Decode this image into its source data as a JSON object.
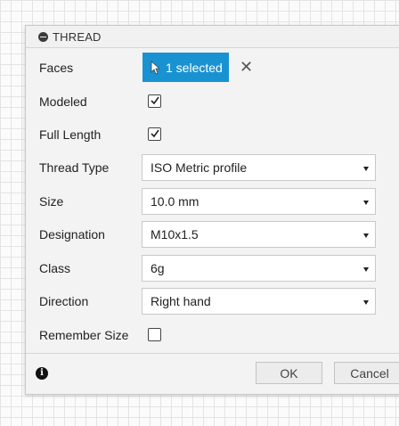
{
  "dialog": {
    "title": "THREAD"
  },
  "fields": {
    "faces": {
      "label": "Faces",
      "selection": "1 selected",
      "clear_icon": "close-icon"
    },
    "modeled": {
      "label": "Modeled",
      "checked": true
    },
    "full_length": {
      "label": "Full Length",
      "checked": true
    },
    "thread_type": {
      "label": "Thread Type",
      "value": "ISO Metric profile"
    },
    "size": {
      "label": "Size",
      "value": "10.0 mm"
    },
    "designation": {
      "label": "Designation",
      "value": "M10x1.5"
    },
    "class": {
      "label": "Class",
      "value": "6g"
    },
    "direction": {
      "label": "Direction",
      "value": "Right hand"
    },
    "remember_size": {
      "label": "Remember Size",
      "checked": false
    }
  },
  "footer": {
    "ok_label": "OK",
    "cancel_label": "Cancel"
  },
  "colors": {
    "accent": "#1992d1",
    "dialog_bg": "#f3f3f3"
  }
}
